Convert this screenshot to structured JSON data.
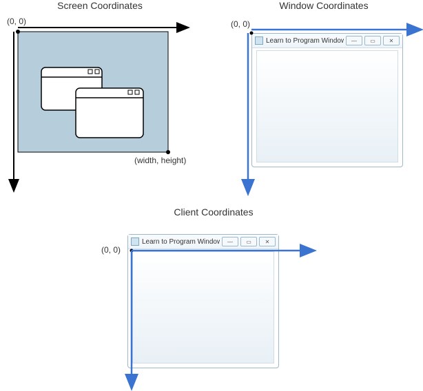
{
  "diagrams": {
    "screen": {
      "title": "Screen Coordinates",
      "origin_label": "(0, 0)",
      "dim_label": "(width, height)"
    },
    "window": {
      "title": "Window Coordinates",
      "origin_label": "(0, 0)",
      "app_title": "Learn to Program Windows"
    },
    "client": {
      "title": "Client Coordinates",
      "origin_label": "(0, 0)",
      "app_title": "Learn to Program Windows"
    }
  },
  "sys_buttons": {
    "minimize": "—",
    "maximize": "▭",
    "close": "✕"
  },
  "colors": {
    "screen_fill": "#b6cddc",
    "arrow_blue": "#3b73d1",
    "arrow_black": "#000000"
  }
}
